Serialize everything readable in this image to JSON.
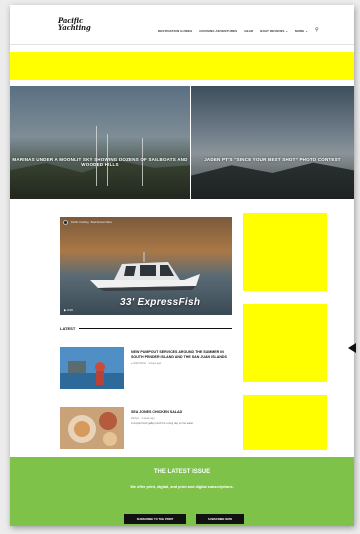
{
  "header": {
    "logo_line1": "Pacific",
    "logo_line2": "Yachting",
    "nav": [
      "Destination Guides",
      "Cruising Adventures",
      "Gear",
      "Boat Reviews ⌄",
      "More ⌄"
    ],
    "search_icon": "⚲"
  },
  "hero": {
    "left_caption": "Marinas Under a Moonlit Sky Showing Dozens of Sailboats and Wooded Hills",
    "right_caption": "Jaden Pt’s “Since Your Best Shot” Photo Contest"
  },
  "video": {
    "channel_title": "Pacific Yachting · Boat Review Video",
    "caption": "33' ExpressFish",
    "control": "▶ 0:00"
  },
  "latest": {
    "label": "Latest",
    "stories": [
      {
        "title": "New Pumpout Services Around the Summer in South Pender Island and the San Juan Islands",
        "meta": "● Staff Writer · 3 days ago"
      },
      {
        "title": "Sea Jones Chicken Salad",
        "meta": "Recipe · 1 week ago",
        "dek": "A simple fresh galley lunch for a long day on the water."
      }
    ]
  },
  "footer": {
    "title": "The Latest Issue",
    "subtitle": "We offer print, digital, and print and digital subscriptions.",
    "subscribe_label": "Subscribe to the print",
    "digital_label": "Subscribe now"
  },
  "colors": {
    "ad_yellow": "#ffff00",
    "footer_green": "#7ec24a"
  }
}
